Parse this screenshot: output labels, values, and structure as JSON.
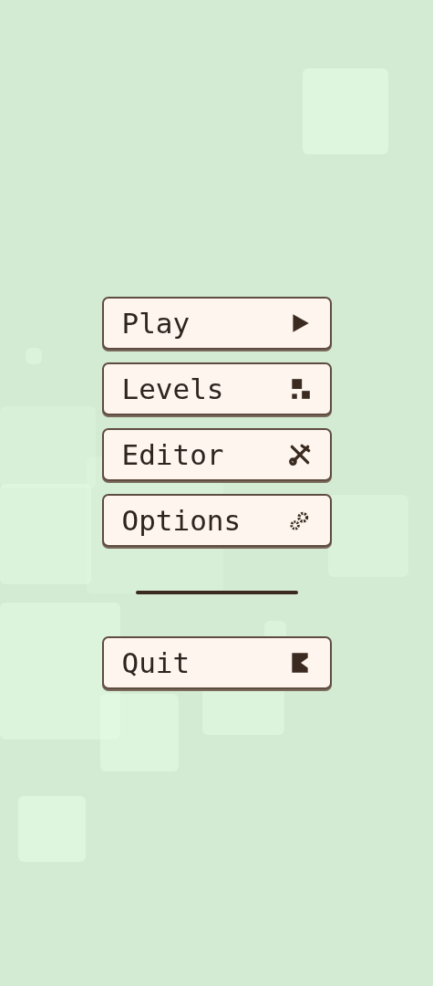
{
  "menu": [
    {
      "label": "Play",
      "kind": "play"
    },
    {
      "label": "Levels",
      "kind": "levels"
    },
    {
      "label": "Editor",
      "kind": "editor"
    },
    {
      "label": "Options",
      "kind": "options"
    }
  ],
  "bottom_menu": [
    {
      "label": "Quit",
      "kind": "quit"
    }
  ]
}
